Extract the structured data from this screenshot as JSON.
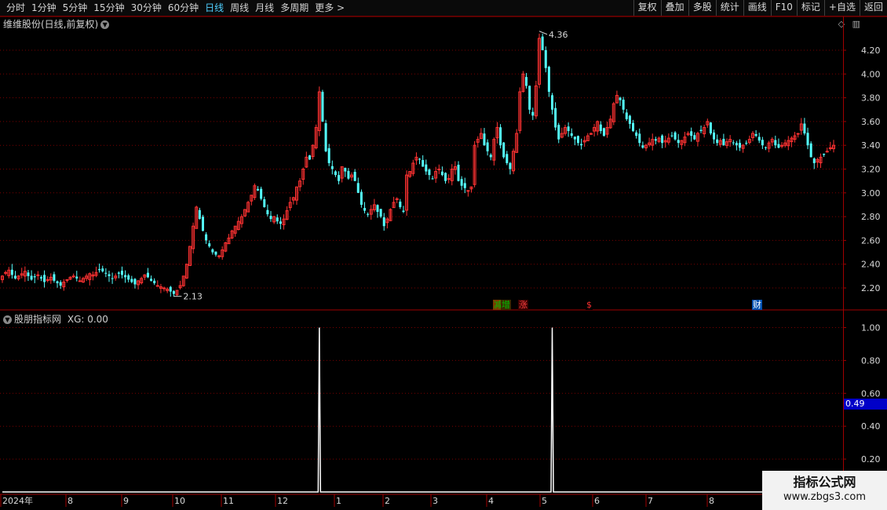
{
  "toolbar": {
    "left_items": [
      "分时",
      "1分钟",
      "5分钟",
      "15分钟",
      "30分钟",
      "60分钟",
      "日线",
      "周线",
      "月线",
      "多周期",
      "更多 >"
    ],
    "active_item": "日线",
    "right_buttons": [
      "复权",
      "叠加",
      "多股",
      "统计",
      "画线",
      "F10",
      "标记",
      "+自选",
      "返回"
    ]
  },
  "main_pane": {
    "title": "维维股份(日线,前复权)",
    "y_ticks": [
      "4.20",
      "4.00",
      "3.80",
      "3.60",
      "3.40",
      "3.20",
      "3.00",
      "2.80",
      "2.60",
      "2.40",
      "2.20"
    ],
    "high_marker": "4.36",
    "low_marker": "2.13",
    "event_badges": [
      {
        "text": "减",
        "color": "#00c000",
        "bg": "#7a3a00"
      },
      {
        "text": "增",
        "color": "#00c000",
        "bg": "#3a2a00"
      },
      {
        "text": "涨",
        "color": "#ff4040",
        "bg": "#3a0000"
      },
      {
        "text": "$",
        "color": "#ff3030",
        "bg": "#000000"
      },
      {
        "text": "财",
        "color": "#ffffff",
        "bg": "#0050b0"
      }
    ]
  },
  "indicator_pane": {
    "title": "股朋指标网",
    "value_label": "XG: 0.00",
    "y_ticks": [
      "1.00",
      "0.80",
      "0.60",
      "0.40",
      "0.20"
    ],
    "current_value": "0.49"
  },
  "x_axis": {
    "labels": [
      "2024年",
      "8",
      "9",
      "10",
      "11",
      "12",
      "1",
      "2",
      "3",
      "4",
      "5",
      "6",
      "7",
      "8"
    ]
  },
  "watermark": {
    "line1": "指标公式网",
    "line2": "www.zbgs3.com"
  },
  "colors": {
    "up": "#ff3232",
    "down": "#54ffff",
    "grid": "#7a0000",
    "axis": "#a00000"
  },
  "chart_data": {
    "type": "candlestick",
    "ylim": [
      2.1,
      4.4
    ],
    "low_point": 2.13,
    "high_point": 4.36,
    "closes": [
      2.3,
      2.33,
      2.35,
      2.31,
      2.28,
      2.3,
      2.32,
      2.34,
      2.3,
      2.27,
      2.29,
      2.31,
      2.28,
      2.25,
      2.27,
      2.29,
      2.26,
      2.24,
      2.22,
      2.25,
      2.27,
      2.29,
      2.3,
      2.28,
      2.26,
      2.28,
      2.3,
      2.32,
      2.31,
      2.33,
      2.35,
      2.34,
      2.32,
      2.3,
      2.28,
      2.3,
      2.32,
      2.31,
      2.29,
      2.27,
      2.25,
      2.23,
      2.26,
      2.28,
      2.31,
      2.29,
      2.26,
      2.24,
      2.22,
      2.21,
      2.2,
      2.19,
      2.17,
      2.15,
      2.18,
      2.22,
      2.3,
      2.4,
      2.55,
      2.72,
      2.88,
      2.78,
      2.68,
      2.6,
      2.55,
      2.5,
      2.48,
      2.47,
      2.52,
      2.58,
      2.62,
      2.68,
      2.72,
      2.76,
      2.8,
      2.86,
      2.92,
      2.98,
      3.06,
      3.02,
      2.95,
      2.88,
      2.82,
      2.78,
      2.8,
      2.76,
      2.74,
      2.78,
      2.85,
      2.92,
      2.96,
      3.05,
      3.1,
      3.2,
      3.3,
      3.28,
      3.4,
      3.55,
      3.85,
      3.6,
      3.35,
      3.25,
      3.2,
      3.15,
      3.1,
      3.22,
      3.18,
      3.12,
      3.15,
      3.1,
      3.0,
      2.9,
      2.85,
      2.82,
      2.86,
      2.9,
      2.84,
      2.8,
      2.72,
      2.78,
      2.86,
      2.92,
      2.95,
      2.88,
      2.84,
      3.15,
      3.18,
      3.25,
      3.3,
      3.28,
      3.22,
      3.18,
      3.15,
      3.12,
      3.18,
      3.2,
      3.15,
      3.1,
      3.12,
      3.2,
      3.22,
      3.1,
      3.06,
      3.04,
      3.02,
      3.05,
      3.4,
      3.45,
      3.5,
      3.4,
      3.35,
      3.3,
      3.45,
      3.55,
      3.4,
      3.3,
      3.25,
      3.2,
      3.35,
      3.5,
      3.85,
      4.0,
      3.9,
      3.7,
      3.65,
      3.9,
      4.3,
      4.2,
      4.05,
      3.85,
      3.7,
      3.55,
      3.45,
      3.5,
      3.55,
      3.52,
      3.48,
      3.45,
      3.42,
      3.4,
      3.44,
      3.48,
      3.5,
      3.55,
      3.6,
      3.52,
      3.48,
      3.55,
      3.62,
      3.75,
      3.82,
      3.78,
      3.7,
      3.62,
      3.58,
      3.52,
      3.48,
      3.42,
      3.38,
      3.4,
      3.42,
      3.45,
      3.44,
      3.46,
      3.42,
      3.44,
      3.46,
      3.48,
      3.45,
      3.42,
      3.44,
      3.47,
      3.5,
      3.48,
      3.45,
      3.5,
      3.52,
      3.55,
      3.6,
      3.5,
      3.45,
      3.42,
      3.44,
      3.4,
      3.43,
      3.45,
      3.42,
      3.4,
      3.38,
      3.4,
      3.42,
      3.45,
      3.5,
      3.48,
      3.44,
      3.4,
      3.38,
      3.42,
      3.45,
      3.4,
      3.38,
      3.4,
      3.42,
      3.44,
      3.46,
      3.48,
      3.5,
      3.58,
      3.5,
      3.4,
      3.3,
      3.25,
      3.28,
      3.3,
      3.32,
      3.35,
      3.38,
      3.4
    ],
    "indicator_spikes": [
      {
        "bar_index": 98,
        "value": 1.0
      },
      {
        "bar_index": 170,
        "value": 1.0
      }
    ]
  }
}
